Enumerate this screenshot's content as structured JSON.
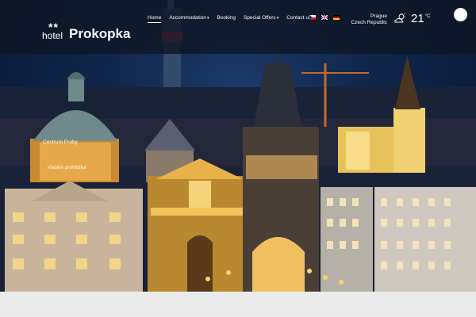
{
  "logo": {
    "stars": "**",
    "hotel": "hotel",
    "name": "Prokopka"
  },
  "nav": [
    {
      "label": "Home",
      "dropdown": false,
      "active": true
    },
    {
      "label": "Accommodation",
      "dropdown": true,
      "active": false
    },
    {
      "label": "Booking",
      "dropdown": false,
      "active": false
    },
    {
      "label": "Special Offers",
      "dropdown": true,
      "active": false
    },
    {
      "label": "Contact us",
      "dropdown": false,
      "active": false
    }
  ],
  "flags": [
    "czech-flag-icon",
    "uk-flag-icon",
    "german-flag-icon"
  ],
  "location": {
    "city": "Prague",
    "country": "Czech Republic"
  },
  "weather": {
    "icon": "partly-cloudy-icon",
    "temperature": "21",
    "unit": "°C"
  },
  "hero": {
    "caption_title": "Centrum Prahy",
    "caption_sub": "Vlastní prohlídka"
  },
  "colors": {
    "topbar": "#0e1624",
    "sky": "#0f2447",
    "lights": "#f5c042"
  }
}
